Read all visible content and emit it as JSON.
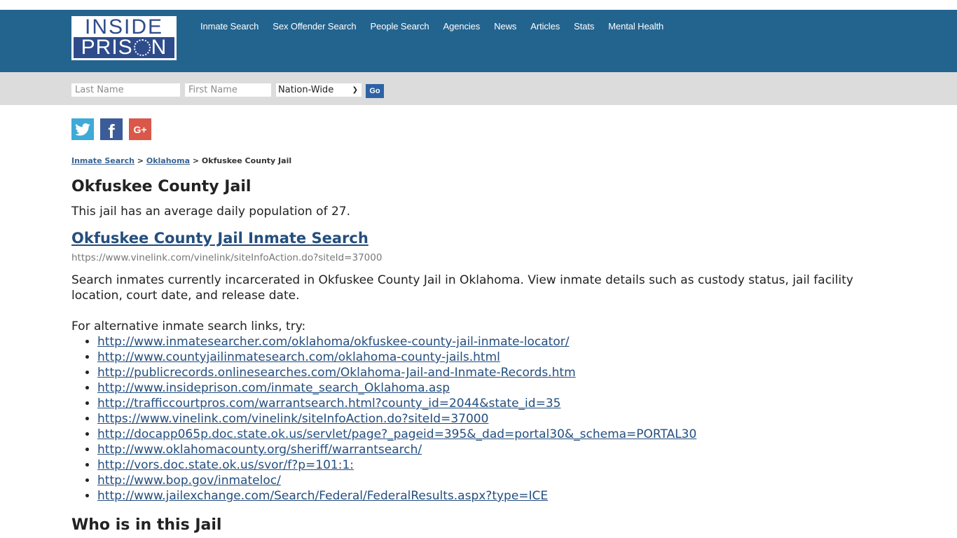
{
  "site": {
    "logo_top": "INSIDE",
    "logo_bottom_left": "PRIS",
    "logo_bottom_right": "N"
  },
  "nav": [
    {
      "label": "Inmate Search"
    },
    {
      "label": "Sex Offender Search"
    },
    {
      "label": "People Search"
    },
    {
      "label": "Agencies"
    },
    {
      "label": "News"
    },
    {
      "label": "Articles"
    },
    {
      "label": "Stats"
    },
    {
      "label": "Mental Health"
    }
  ],
  "search": {
    "last_name_placeholder": "Last Name",
    "first_name_placeholder": "First Name",
    "scope_selected": "Nation-Wide",
    "go_label": "Go"
  },
  "social": [
    {
      "icon": "twitter-icon",
      "glyph": "t"
    },
    {
      "icon": "facebook-icon",
      "glyph": "f"
    },
    {
      "icon": "google-plus-icon",
      "glyph": "G+"
    }
  ],
  "breadcrumb": {
    "items": [
      "Inmate Search",
      "Oklahoma"
    ],
    "separator": ">",
    "current": "Okfuskee County Jail"
  },
  "main": {
    "title": "Okfuskee County Jail",
    "population_text": "This jail has an average daily population of 27.",
    "search_link_label": "Okfuskee County Jail Inmate Search",
    "search_link_url": "https://www.vinelink.com/vinelink/siteInfoAction.do?siteId=37000",
    "description": "Search inmates currently incarcerated in Okfuskee County Jail in Oklahoma. View inmate details such as custody status, jail facility location, court date, and release date.",
    "alt_intro": "For alternative inmate search links, try:",
    "alt_links": [
      "http://www.inmatesearcher.com/oklahoma/okfuskee-county-jail-inmate-locator/",
      "http://www.countyjailinmatesearch.com/oklahoma-county-jails.html",
      "http://publicrecords.onlinesearches.com/Oklahoma-Jail-and-Inmate-Records.htm",
      "http://www.insideprison.com/inmate_search_Oklahoma.asp",
      "http://trafficcourtpros.com/warrantsearch.html?county_id=2044&state_id=35",
      "https://www.vinelink.com/vinelink/siteInfoAction.do?siteId=37000",
      "http://docapp065p.doc.state.ok.us/servlet/page?_pageid=395&_dad=portal30&_schema=PORTAL30",
      "http://www.oklahomacounty.org/sheriff/warrantsearch/",
      "http://vors.doc.state.ok.us/svor/f?p=101:1:",
      "http://www.bop.gov/inmateloc/",
      "http://www.jailexchange.com/Search/Federal/FederalResults.aspx?type=ICE"
    ],
    "who_heading": "Who is in this Jail"
  },
  "colors": {
    "header_bg": "#23648f",
    "search_bg": "#dcdcdc",
    "link": "#244e7e",
    "go_button": "#2d63a6",
    "twitter": "#3eaad8",
    "facebook": "#3b5b99",
    "google_plus": "#d9584a"
  }
}
